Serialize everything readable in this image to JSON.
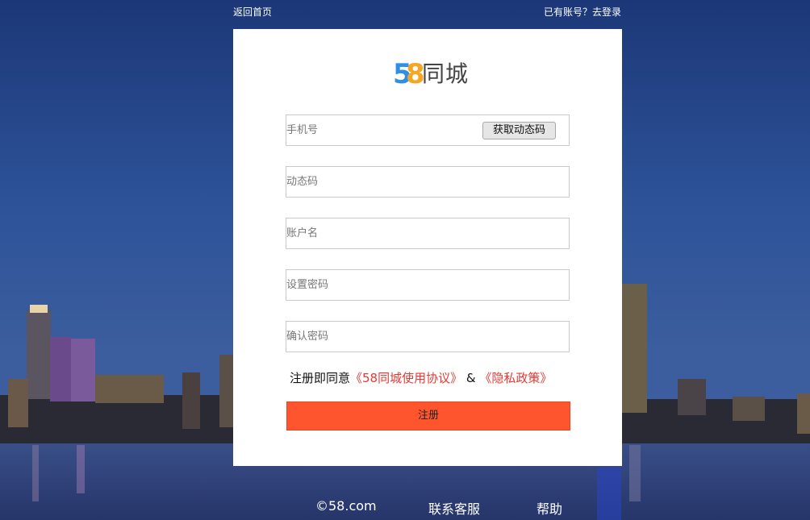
{
  "topnav": {
    "home_label": "返回首页",
    "login_label": "已有账号？去登录"
  },
  "logo": {
    "digit1": "5",
    "digit2": "8",
    "text": "同城"
  },
  "form": {
    "phone_placeholder": "手机号",
    "sms_button_label": "获取动态码",
    "code_placeholder": "动态码",
    "account_placeholder": "账户名",
    "password_placeholder": "设置密码",
    "confirm_placeholder": "确认密码",
    "agree_prefix": "注册即同意",
    "agreement_link": "《58同城使用协议》",
    "amp": "&",
    "privacy_link": "《隐私政策》",
    "submit_label": "注册"
  },
  "footer": {
    "copyright": "©58.com",
    "service_label": "联系客服",
    "help_label": "帮助"
  },
  "colors": {
    "accent": "#ff552e",
    "link_red": "#e53935",
    "logo_blue": "#2d8fe6",
    "logo_orange": "#f5a623"
  }
}
